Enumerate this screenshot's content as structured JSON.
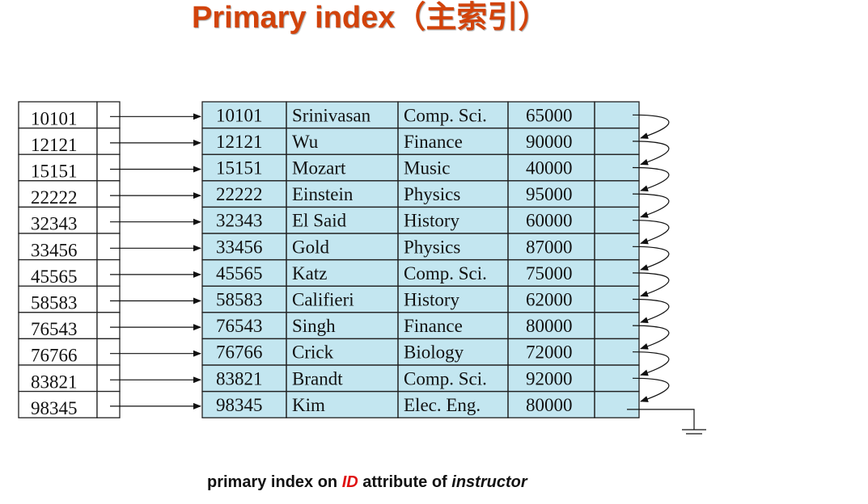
{
  "title": "Primary index（主索引）",
  "index_keys": [
    "10101",
    "12121",
    "15151",
    "22222",
    "32343",
    "33456",
    "45565",
    "58583",
    "76543",
    "76766",
    "83821",
    "98345"
  ],
  "records": [
    {
      "id": "10101",
      "name": "Srinivasan",
      "dept": "Comp. Sci.",
      "salary": "65000"
    },
    {
      "id": "12121",
      "name": "Wu",
      "dept": "Finance",
      "salary": "90000"
    },
    {
      "id": "15151",
      "name": "Mozart",
      "dept": "Music",
      "salary": "40000"
    },
    {
      "id": "22222",
      "name": "Einstein",
      "dept": "Physics",
      "salary": "95000"
    },
    {
      "id": "32343",
      "name": "El Said",
      "dept": "History",
      "salary": "60000"
    },
    {
      "id": "33456",
      "name": "Gold",
      "dept": "Physics",
      "salary": "87000"
    },
    {
      "id": "45565",
      "name": "Katz",
      "dept": "Comp. Sci.",
      "salary": "75000"
    },
    {
      "id": "58583",
      "name": "Califieri",
      "dept": "History",
      "salary": "62000"
    },
    {
      "id": "76543",
      "name": "Singh",
      "dept": "Finance",
      "salary": "80000"
    },
    {
      "id": "76766",
      "name": "Crick",
      "dept": "Biology",
      "salary": "72000"
    },
    {
      "id": "83821",
      "name": "Brandt",
      "dept": "Comp. Sci.",
      "salary": "92000"
    },
    {
      "id": "98345",
      "name": "Kim",
      "dept": "Elec. Eng.",
      "salary": "80000"
    }
  ],
  "caption": {
    "part1": "primary index on ",
    "keyword": "ID",
    "part2": " attribute of ",
    "relation": "instructor"
  },
  "colors": {
    "title": "#d2430b",
    "record_fill": "#c3e6f0",
    "keyword": "#e01010"
  }
}
